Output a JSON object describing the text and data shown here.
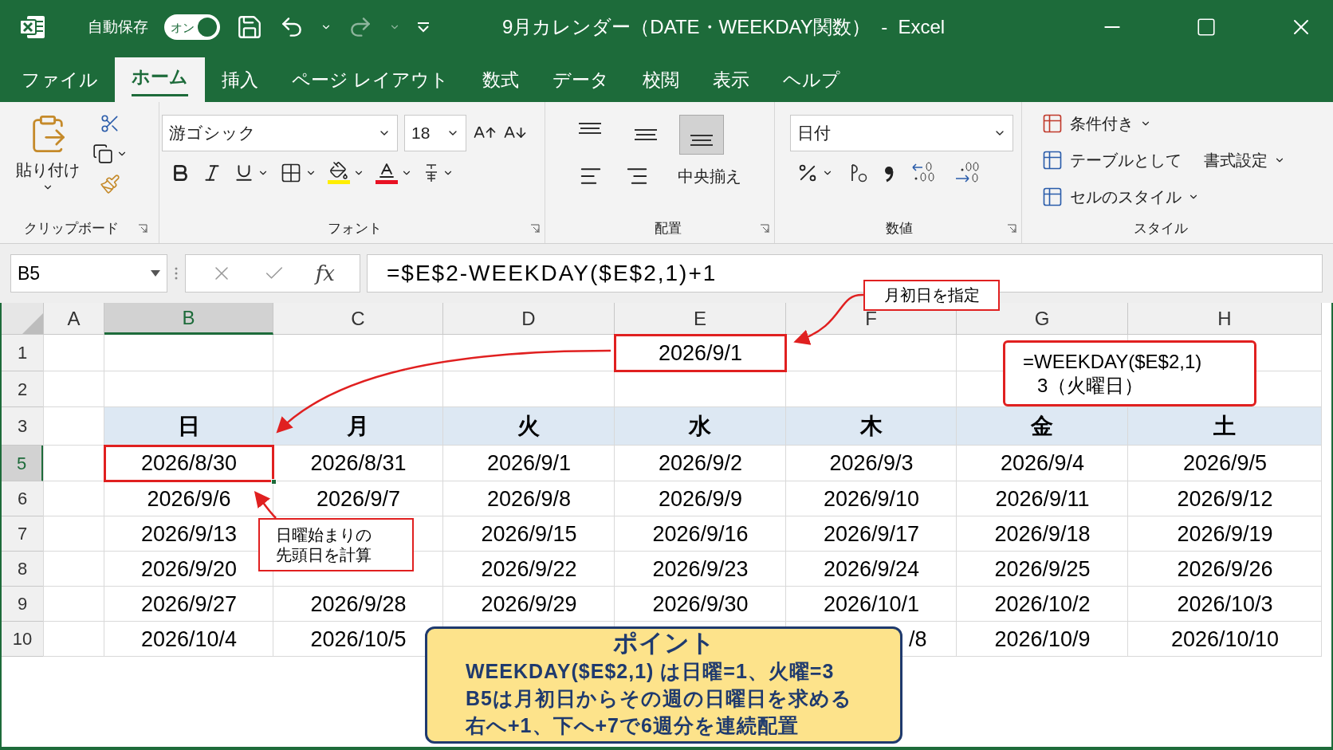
{
  "title_bar": {
    "autosave_label": "自動保存",
    "autosave": {
      "label": "オン",
      "on": true
    },
    "title": "9月カレンダー（DATE・WEEKDAY関数）  -  Excel"
  },
  "tabs": [
    {
      "label": "ファイル",
      "selected": false
    },
    {
      "label": "ホーム",
      "selected": true
    },
    {
      "label": "挿入",
      "selected": false
    },
    {
      "label": "ページ レイアウト",
      "selected": false
    },
    {
      "label": "数式",
      "selected": false
    },
    {
      "label": "データ",
      "selected": false
    },
    {
      "label": "校閲",
      "selected": false
    },
    {
      "label": "表示",
      "selected": false
    },
    {
      "label": "ヘルプ",
      "selected": false
    }
  ],
  "ribbon": {
    "clipboard": {
      "paste": "貼り付け",
      "group": "クリップボード"
    },
    "font": {
      "name": "游ゴシック",
      "size": "18",
      "group": "フォント"
    },
    "alignment": {
      "vertical": [
        {
          "selected": false
        },
        {
          "selected": false
        },
        {
          "selected": true
        }
      ],
      "merge": "中央揃え",
      "group": "配置"
    },
    "number": {
      "format": "日付",
      "group": "数値"
    },
    "styles": {
      "items": [
        {
          "label": "条件付き"
        },
        {
          "label": "テーブルとして",
          "extra": "書式設定"
        },
        {
          "label": "セルのスタイル"
        }
      ],
      "group": "スタイル"
    }
  },
  "formula_bar": {
    "name_box": "B5",
    "fx": "fx",
    "formula": "=$E$2-WEEKDAY($E$2,1)+1"
  },
  "sheet": {
    "columns": [
      {
        "label": "A",
        "selected": false
      },
      {
        "label": "B",
        "selected": true
      },
      {
        "label": "C",
        "selected": false
      },
      {
        "label": "D",
        "selected": false
      },
      {
        "label": "E",
        "selected": false
      },
      {
        "label": "F",
        "selected": false
      },
      {
        "label": "G",
        "selected": false
      },
      {
        "label": "H",
        "selected": false
      }
    ],
    "rows": [
      {
        "header": "1",
        "selected": false,
        "kind": "plain",
        "cells": [
          null,
          null,
          null,
          null,
          {
            "text": "2026/9/1",
            "highlighted": true
          },
          null,
          null,
          null
        ]
      },
      {
        "header": "2",
        "selected": false,
        "kind": "plain",
        "cells": [
          null,
          null,
          null,
          null,
          null,
          null,
          null,
          null
        ]
      },
      {
        "header": "3",
        "selected": false,
        "kind": "weekdays",
        "cells": [
          null,
          "日",
          "月",
          "火",
          "水",
          "木",
          "金",
          "土"
        ]
      },
      {
        "header": "5",
        "selected": true,
        "kind": "plain",
        "cells": [
          null,
          {
            "text": "2026/8/30",
            "highlighted": true,
            "active": true
          },
          "2026/8/31",
          "2026/9/1",
          "2026/9/2",
          "2026/9/3",
          "2026/9/4",
          "2026/9/5"
        ]
      },
      {
        "header": "6",
        "selected": false,
        "kind": "plain",
        "cells": [
          null,
          "2026/9/6",
          "2026/9/7",
          "2026/9/8",
          "2026/9/9",
          "2026/9/10",
          "2026/9/11",
          "2026/9/12"
        ]
      },
      {
        "header": "7",
        "selected": false,
        "kind": "plain",
        "cells": [
          null,
          "2026/9/13",
          null,
          "2026/9/15",
          "2026/9/16",
          "2026/9/17",
          "2026/9/18",
          "2026/9/19"
        ]
      },
      {
        "header": "8",
        "selected": false,
        "kind": "plain",
        "cells": [
          null,
          "2026/9/20",
          null,
          "2026/9/22",
          "2026/9/23",
          "2026/9/24",
          "2026/9/25",
          "2026/9/26"
        ]
      },
      {
        "header": "9",
        "selected": false,
        "kind": "plain",
        "cells": [
          null,
          "2026/9/27",
          "2026/9/28",
          "2026/9/29",
          "2026/9/30",
          "2026/10/1",
          "2026/10/2",
          "2026/10/3"
        ]
      },
      {
        "header": "10",
        "selected": false,
        "kind": "plain",
        "cells": [
          null,
          "2026/10/4",
          "2026/10/5",
          null,
          null,
          {
            "text": "/8",
            "clipped": true
          },
          "2026/10/9",
          "2026/10/10"
        ]
      }
    ]
  },
  "callouts": [
    {
      "lines": [
        "月初日を指定"
      ]
    },
    {
      "lines": [
        "=WEEKDAY($E$2,1)",
        "3（火曜日）"
      ]
    },
    {
      "lines": [
        "日曜始まりの",
        "先頭日を計算"
      ]
    }
  ],
  "point": {
    "title": "ポイント",
    "lines": [
      "WEEKDAY($E$2,1) は日曜=1、火曜=3",
      "B5は月初日からその週の日曜日を求める",
      "右へ+1、下へ+7で6週分を連続配置"
    ]
  }
}
